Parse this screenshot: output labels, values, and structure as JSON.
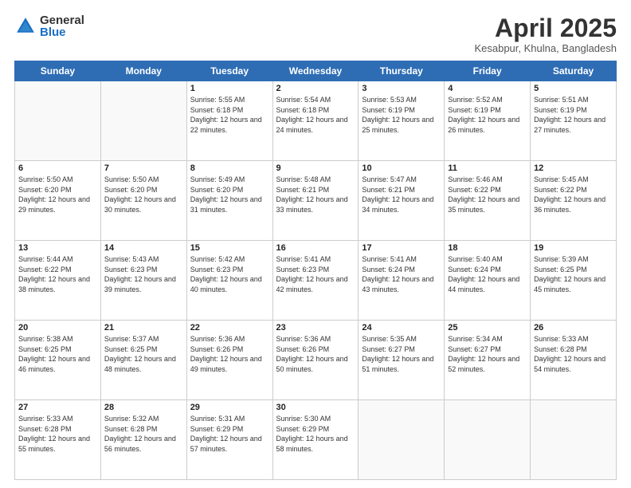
{
  "logo": {
    "general": "General",
    "blue": "Blue"
  },
  "header": {
    "month_year": "April 2025",
    "location": "Kesabpur, Khulna, Bangladesh"
  },
  "days_of_week": [
    "Sunday",
    "Monday",
    "Tuesday",
    "Wednesday",
    "Thursday",
    "Friday",
    "Saturday"
  ],
  "weeks": [
    [
      {
        "day": "",
        "info": ""
      },
      {
        "day": "",
        "info": ""
      },
      {
        "day": "1",
        "info": "Sunrise: 5:55 AM\nSunset: 6:18 PM\nDaylight: 12 hours and 22 minutes."
      },
      {
        "day": "2",
        "info": "Sunrise: 5:54 AM\nSunset: 6:18 PM\nDaylight: 12 hours and 24 minutes."
      },
      {
        "day": "3",
        "info": "Sunrise: 5:53 AM\nSunset: 6:19 PM\nDaylight: 12 hours and 25 minutes."
      },
      {
        "day": "4",
        "info": "Sunrise: 5:52 AM\nSunset: 6:19 PM\nDaylight: 12 hours and 26 minutes."
      },
      {
        "day": "5",
        "info": "Sunrise: 5:51 AM\nSunset: 6:19 PM\nDaylight: 12 hours and 27 minutes."
      }
    ],
    [
      {
        "day": "6",
        "info": "Sunrise: 5:50 AM\nSunset: 6:20 PM\nDaylight: 12 hours and 29 minutes."
      },
      {
        "day": "7",
        "info": "Sunrise: 5:50 AM\nSunset: 6:20 PM\nDaylight: 12 hours and 30 minutes."
      },
      {
        "day": "8",
        "info": "Sunrise: 5:49 AM\nSunset: 6:20 PM\nDaylight: 12 hours and 31 minutes."
      },
      {
        "day": "9",
        "info": "Sunrise: 5:48 AM\nSunset: 6:21 PM\nDaylight: 12 hours and 33 minutes."
      },
      {
        "day": "10",
        "info": "Sunrise: 5:47 AM\nSunset: 6:21 PM\nDaylight: 12 hours and 34 minutes."
      },
      {
        "day": "11",
        "info": "Sunrise: 5:46 AM\nSunset: 6:22 PM\nDaylight: 12 hours and 35 minutes."
      },
      {
        "day": "12",
        "info": "Sunrise: 5:45 AM\nSunset: 6:22 PM\nDaylight: 12 hours and 36 minutes."
      }
    ],
    [
      {
        "day": "13",
        "info": "Sunrise: 5:44 AM\nSunset: 6:22 PM\nDaylight: 12 hours and 38 minutes."
      },
      {
        "day": "14",
        "info": "Sunrise: 5:43 AM\nSunset: 6:23 PM\nDaylight: 12 hours and 39 minutes."
      },
      {
        "day": "15",
        "info": "Sunrise: 5:42 AM\nSunset: 6:23 PM\nDaylight: 12 hours and 40 minutes."
      },
      {
        "day": "16",
        "info": "Sunrise: 5:41 AM\nSunset: 6:23 PM\nDaylight: 12 hours and 42 minutes."
      },
      {
        "day": "17",
        "info": "Sunrise: 5:41 AM\nSunset: 6:24 PM\nDaylight: 12 hours and 43 minutes."
      },
      {
        "day": "18",
        "info": "Sunrise: 5:40 AM\nSunset: 6:24 PM\nDaylight: 12 hours and 44 minutes."
      },
      {
        "day": "19",
        "info": "Sunrise: 5:39 AM\nSunset: 6:25 PM\nDaylight: 12 hours and 45 minutes."
      }
    ],
    [
      {
        "day": "20",
        "info": "Sunrise: 5:38 AM\nSunset: 6:25 PM\nDaylight: 12 hours and 46 minutes."
      },
      {
        "day": "21",
        "info": "Sunrise: 5:37 AM\nSunset: 6:25 PM\nDaylight: 12 hours and 48 minutes."
      },
      {
        "day": "22",
        "info": "Sunrise: 5:36 AM\nSunset: 6:26 PM\nDaylight: 12 hours and 49 minutes."
      },
      {
        "day": "23",
        "info": "Sunrise: 5:36 AM\nSunset: 6:26 PM\nDaylight: 12 hours and 50 minutes."
      },
      {
        "day": "24",
        "info": "Sunrise: 5:35 AM\nSunset: 6:27 PM\nDaylight: 12 hours and 51 minutes."
      },
      {
        "day": "25",
        "info": "Sunrise: 5:34 AM\nSunset: 6:27 PM\nDaylight: 12 hours and 52 minutes."
      },
      {
        "day": "26",
        "info": "Sunrise: 5:33 AM\nSunset: 6:28 PM\nDaylight: 12 hours and 54 minutes."
      }
    ],
    [
      {
        "day": "27",
        "info": "Sunrise: 5:33 AM\nSunset: 6:28 PM\nDaylight: 12 hours and 55 minutes."
      },
      {
        "day": "28",
        "info": "Sunrise: 5:32 AM\nSunset: 6:28 PM\nDaylight: 12 hours and 56 minutes."
      },
      {
        "day": "29",
        "info": "Sunrise: 5:31 AM\nSunset: 6:29 PM\nDaylight: 12 hours and 57 minutes."
      },
      {
        "day": "30",
        "info": "Sunrise: 5:30 AM\nSunset: 6:29 PM\nDaylight: 12 hours and 58 minutes."
      },
      {
        "day": "",
        "info": ""
      },
      {
        "day": "",
        "info": ""
      },
      {
        "day": "",
        "info": ""
      }
    ]
  ]
}
